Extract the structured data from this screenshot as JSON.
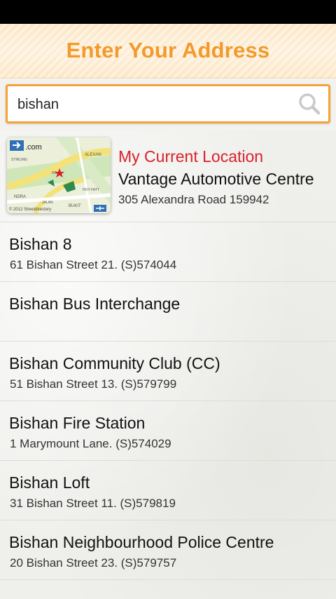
{
  "header": {
    "title": "Enter Your Address"
  },
  "search": {
    "value": "bishan"
  },
  "current_location": {
    "label": "My Current Location",
    "name": "Vantage Automotive Centre",
    "address": "305 Alexandra Road 159942",
    "map": {
      "brand": ".com",
      "labels": [
        "STIRLING",
        "ALEXAN",
        "RD",
        "NDRA",
        "HOY FATT",
        "JALAN",
        "BUKIT"
      ],
      "copyright": "© 2012 Streetdirectory"
    }
  },
  "results": [
    {
      "name": "Bishan 8",
      "address": "61 Bishan Street 21. (S)574044"
    },
    {
      "name": "Bishan Bus Interchange",
      "address": ""
    },
    {
      "name": "Bishan Community Club (CC)",
      "address": "51 Bishan Street 13. (S)579799"
    },
    {
      "name": "Bishan Fire Station",
      "address": "1 Marymount Lane. (S)574029"
    },
    {
      "name": "Bishan Loft",
      "address": "31 Bishan Street 11. (S)579819"
    },
    {
      "name": "Bishan Neighbourhood Police Centre",
      "address": "20 Bishan Street 23. (S)579757"
    }
  ],
  "colors": {
    "title": "#f39a2b",
    "search_border": "#f4a23a",
    "current_label": "#d8222a"
  }
}
